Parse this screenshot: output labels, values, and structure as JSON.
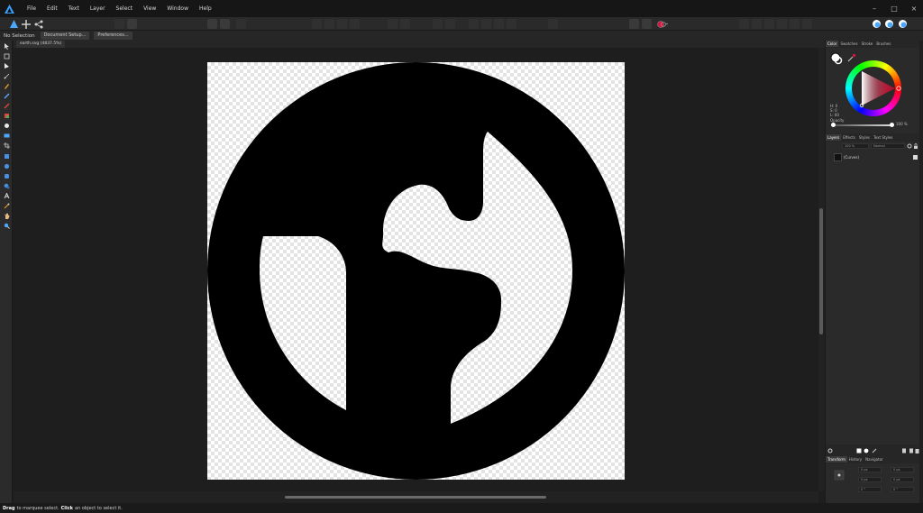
{
  "menu": [
    "File",
    "Edit",
    "Text",
    "Layer",
    "Select",
    "View",
    "Window",
    "Help"
  ],
  "window_controls": [
    "–",
    "□",
    "×"
  ],
  "context": {
    "selection_label": "No Selection",
    "doc_setup_label": "Document Setup...",
    "preferences_label": "Preferences..."
  },
  "document": {
    "tab_label": "earth.svg (4837.5%)"
  },
  "color_panel": {
    "tabs": [
      "Color",
      "Swatches",
      "Stroke",
      "Brushes"
    ],
    "h_label": "H: 0",
    "s_label": "S: 0",
    "l_label": "L: 60",
    "opacity_label": "Opacity",
    "opacity_value": "100 %",
    "accent": "#d4143b"
  },
  "layers_panel": {
    "tabs": [
      "Layers",
      "Effects",
      "Styles",
      "Text Styles"
    ],
    "opacity_value": "100 %",
    "blend_mode": "Normal",
    "layer_name": "(Curves)"
  },
  "transform_panel": {
    "tabs": [
      "Transform",
      "History",
      "Navigator"
    ],
    "fields": [
      "0 px",
      "0 px",
      "0 px",
      "0 px",
      "0 °",
      "0 °"
    ]
  },
  "status": {
    "drag_bold": "Drag",
    "drag_text": "to marquee select.",
    "click_bold": "Click",
    "click_text": "an object to select it."
  }
}
